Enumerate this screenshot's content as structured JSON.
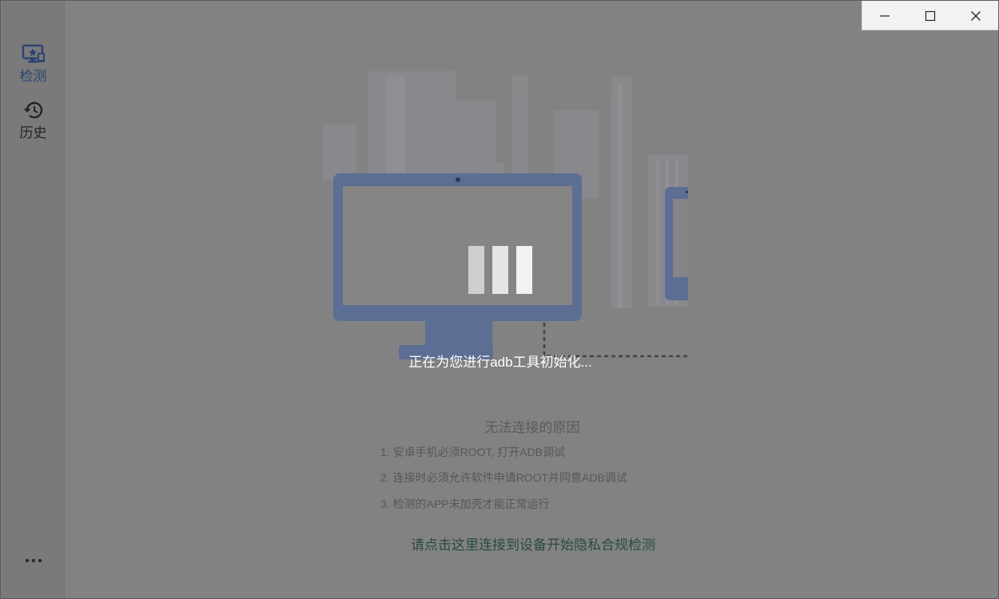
{
  "window": {
    "controls": {
      "minimize_icon": "minimize-icon",
      "maximize_icon": "maximize-icon",
      "close_icon": "close-icon"
    }
  },
  "sidebar": {
    "items": [
      {
        "label": "检测",
        "icon": "monitor-star-icon",
        "active": true
      },
      {
        "label": "历史",
        "icon": "history-icon",
        "active": false
      }
    ],
    "more_icon": "more-dots-icon"
  },
  "main": {
    "loading_text": "正在为您进行adb工具初始化...",
    "reasons_title": "无法连接的原因",
    "reasons": [
      "1. 安卓手机必须ROOT, 打开ADB调试",
      "2. 连接时必须允许软件申请ROOT并同意ADB调试",
      "3. 检测的APP未加壳才能正常运行"
    ],
    "connect_link": "请点击这里连接到设备开始隐私合规检测"
  },
  "colors": {
    "accent": "#2c4472",
    "device_blue": "#5d6e95",
    "overlay": "#7f7f7f",
    "link": "#2a4a3f"
  }
}
